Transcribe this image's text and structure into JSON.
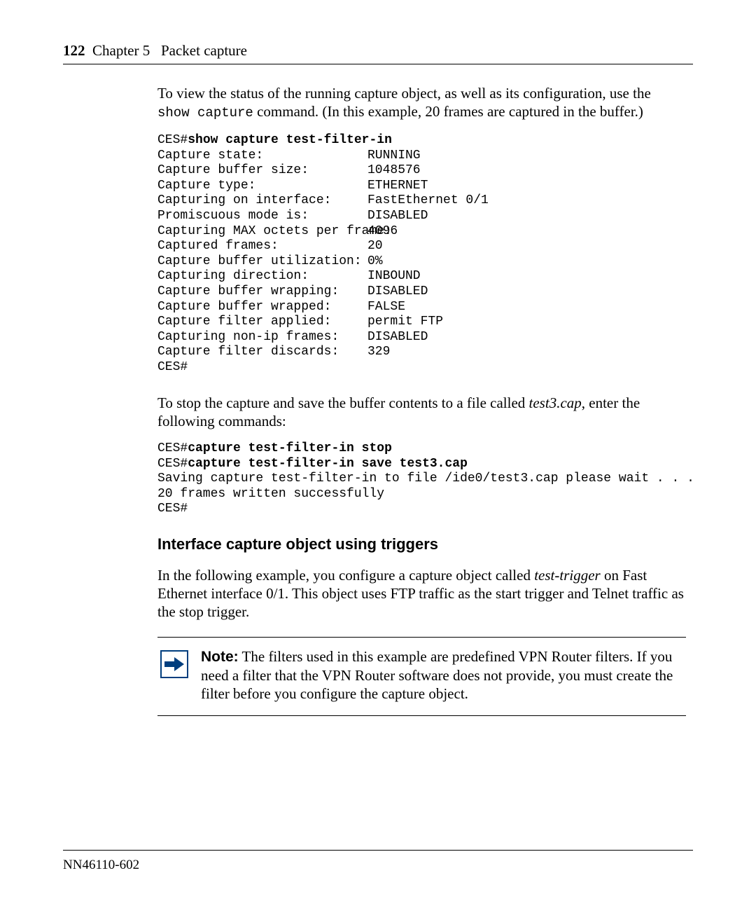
{
  "header": {
    "page_number": "122",
    "chapter_label": "Chapter 5",
    "chapter_title": "Packet capture"
  },
  "intro_para": {
    "pre": "To view the status of the running capture object, as well as its configuration, use the ",
    "cmd": "show capture",
    "post": " command. (In this example, 20 frames are captured in the buffer.)"
  },
  "terminal1": {
    "prompt": "CES#",
    "cmd": "show capture test-filter-in",
    "rows": [
      {
        "label": "Capture state:",
        "value": "RUNNING"
      },
      {
        "label": "Capture buffer size:",
        "value": "1048576"
      },
      {
        "label": "Capture type:",
        "value": "ETHERNET"
      },
      {
        "label": "Capturing on interface:",
        "value": "FastEthernet 0/1"
      },
      {
        "label": "Promiscuous mode is:",
        "value": "DISABLED"
      },
      {
        "label": "Capturing MAX octets per frame:",
        "value": "4096"
      },
      {
        "label": "Captured frames:",
        "value": "20"
      },
      {
        "label": "Capture buffer utilization:",
        "value": "0%"
      },
      {
        "label": "Capturing direction:",
        "value": "INBOUND"
      },
      {
        "label": "Capture buffer wrapping:",
        "value": "DISABLED"
      },
      {
        "label": "Capture buffer wrapped:",
        "value": "FALSE"
      },
      {
        "label": "Capture filter applied:",
        "value": "permit FTP"
      },
      {
        "label": "Capturing non-ip frames:",
        "value": "DISABLED"
      },
      {
        "label": "Capture filter discards:",
        "value": "329"
      }
    ],
    "trailing_prompt": "CES#"
  },
  "stop_para": {
    "pre": "To stop the capture and save the buffer contents to a file called ",
    "filename": "test3.cap",
    "post": ", enter the following commands:"
  },
  "terminal2": {
    "line1_prompt": "CES#",
    "line1_cmd": "capture test-filter-in stop",
    "line2_prompt": "CES#",
    "line2_cmd": "capture test-filter-in save test3.cap",
    "output1": "Saving capture test-filter-in to file /ide0/test3.cap please wait . . .",
    "output2": "20 frames written successfully",
    "trailing_prompt": "CES#"
  },
  "section_heading": "Interface capture object using triggers",
  "trigger_para": {
    "pre": "In the following example, you configure a capture object called ",
    "obj": "test-trigger",
    "post": " on Fast Ethernet interface 0/1. This object uses FTP traffic as the start trigger and Telnet traffic as the stop trigger."
  },
  "note": {
    "label": "Note:",
    "text": " The filters used in this example are predefined VPN Router filters. If you need a filter that the VPN Router software does not provide, you must create the filter before you configure the capture object."
  },
  "footer": {
    "doc_id": "NN46110-602"
  }
}
